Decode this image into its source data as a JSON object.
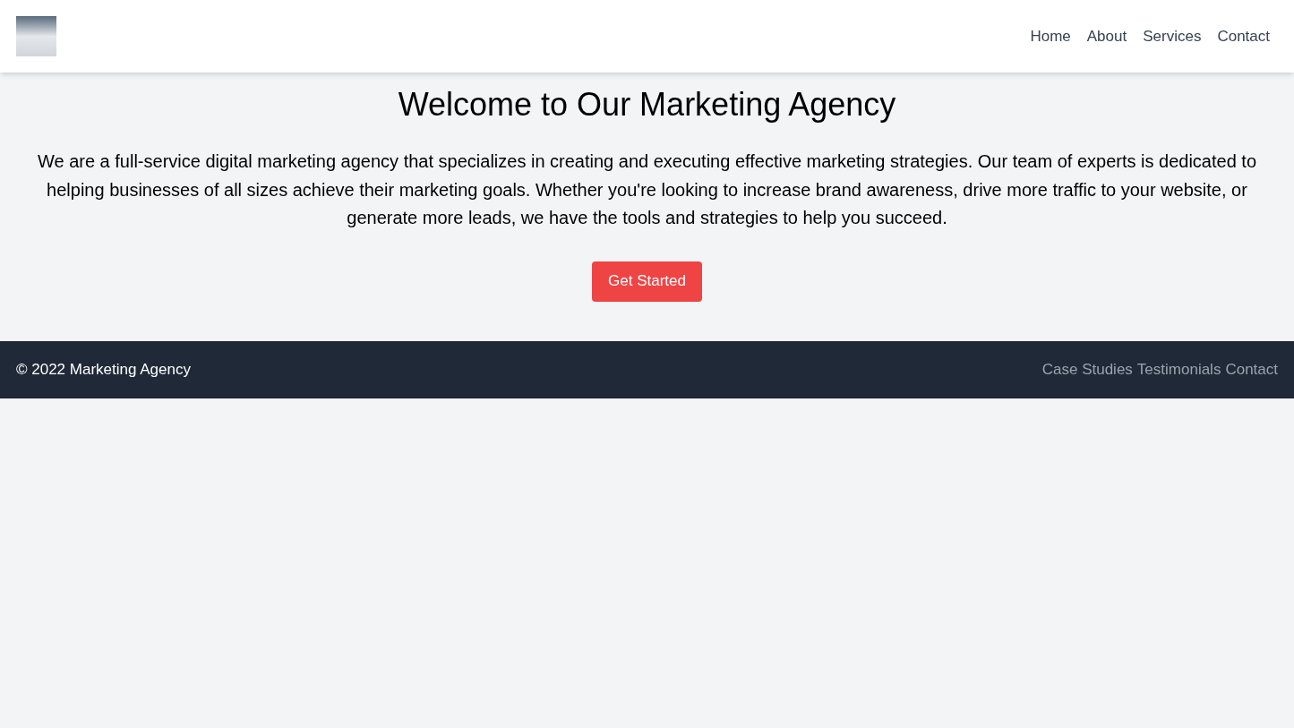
{
  "header": {
    "nav": [
      "Home",
      "About",
      "Services",
      "Contact"
    ]
  },
  "hero": {
    "title": "Welcome to Our Marketing Agency",
    "text": "We are a full-service digital marketing agency that specializes in creating and executing effective marketing strategies. Our team of experts is dedicated to helping businesses of all sizes achieve their marketing goals. Whether you're looking to increase brand awareness, drive more traffic to your website, or generate more leads, we have the tools and strategies to help you succeed.",
    "button": "Get Started"
  },
  "footer": {
    "copyright": "© 2022 Marketing Agency",
    "links": [
      "Case Studies",
      "Testimonials",
      "Contact"
    ]
  }
}
